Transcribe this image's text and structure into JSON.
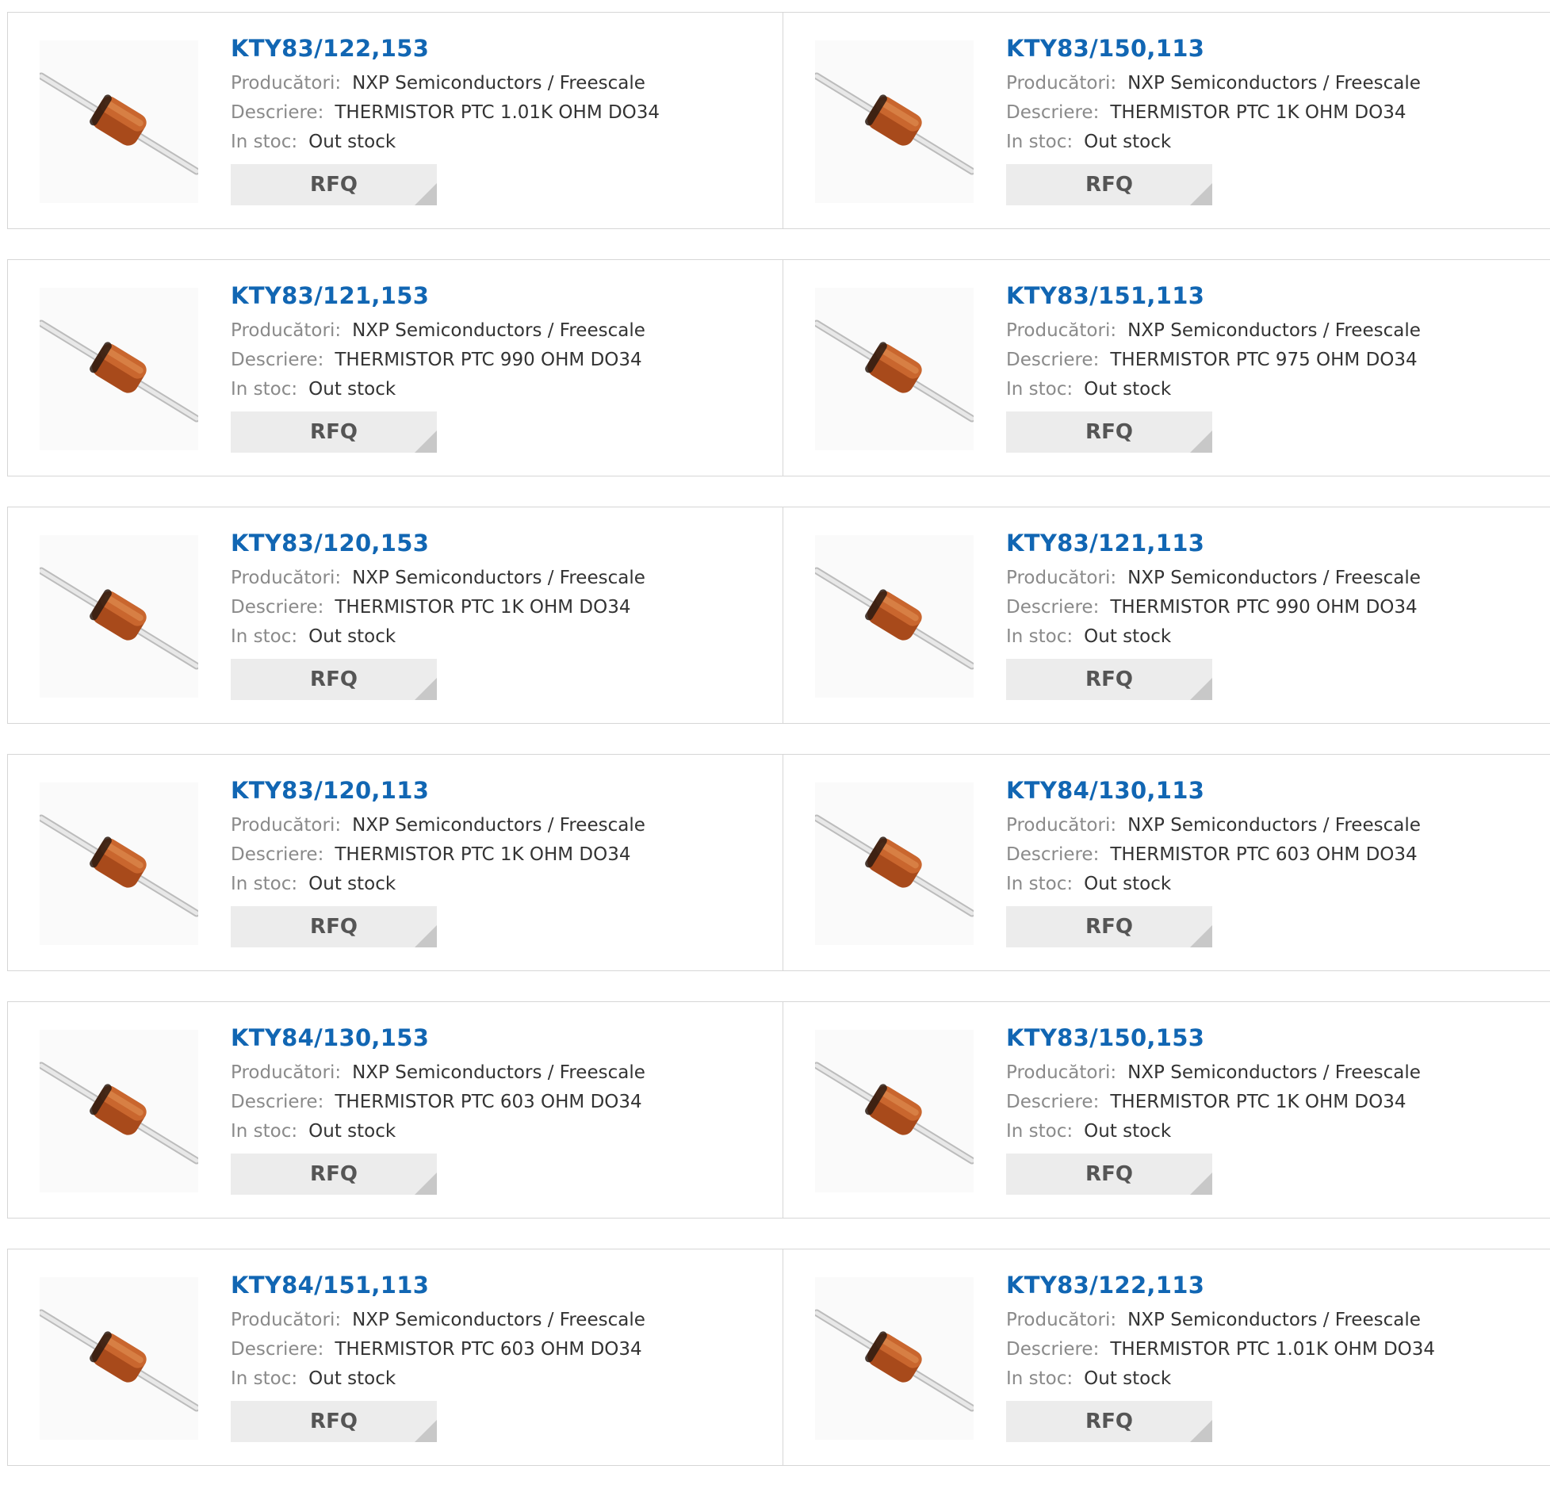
{
  "labels": {
    "manufacturer": "Producători:",
    "description": "Descriere:",
    "stock": "In stoc:",
    "rfq": "RFQ"
  },
  "products": [
    {
      "part": "KTY83/122,153",
      "manufacturer": "NXP Semiconductors / Freescale",
      "description": "THERMISTOR PTC 1.01K OHM DO34",
      "stock": "Out stock"
    },
    {
      "part": "KTY83/150,113",
      "manufacturer": "NXP Semiconductors / Freescale",
      "description": "THERMISTOR PTC 1K OHM DO34",
      "stock": "Out stock"
    },
    {
      "part": "KTY83/121,153",
      "manufacturer": "NXP Semiconductors / Freescale",
      "description": "THERMISTOR PTC 990 OHM DO34",
      "stock": "Out stock"
    },
    {
      "part": "KTY83/151,113",
      "manufacturer": "NXP Semiconductors / Freescale",
      "description": "THERMISTOR PTC 975 OHM DO34",
      "stock": "Out stock"
    },
    {
      "part": "KTY83/120,153",
      "manufacturer": "NXP Semiconductors / Freescale",
      "description": "THERMISTOR PTC 1K OHM DO34",
      "stock": "Out stock"
    },
    {
      "part": "KTY83/121,113",
      "manufacturer": "NXP Semiconductors / Freescale",
      "description": "THERMISTOR PTC 990 OHM DO34",
      "stock": "Out stock"
    },
    {
      "part": "KTY83/120,113",
      "manufacturer": "NXP Semiconductors / Freescale",
      "description": "THERMISTOR PTC 1K OHM DO34",
      "stock": "Out stock"
    },
    {
      "part": "KTY84/130,113",
      "manufacturer": "NXP Semiconductors / Freescale",
      "description": "THERMISTOR PTC 603 OHM DO34",
      "stock": "Out stock"
    },
    {
      "part": "KTY84/130,153",
      "manufacturer": "NXP Semiconductors / Freescale",
      "description": "THERMISTOR PTC 603 OHM DO34",
      "stock": "Out stock"
    },
    {
      "part": "KTY83/150,153",
      "manufacturer": "NXP Semiconductors / Freescale",
      "description": "THERMISTOR PTC 1K OHM DO34",
      "stock": "Out stock"
    },
    {
      "part": "KTY84/151,113",
      "manufacturer": "NXP Semiconductors / Freescale",
      "description": "THERMISTOR PTC 603 OHM DO34",
      "stock": "Out stock"
    },
    {
      "part": "KTY83/122,113",
      "manufacturer": "NXP Semiconductors / Freescale",
      "description": "THERMISTOR PTC 1.01K OHM DO34",
      "stock": "Out stock"
    }
  ],
  "colors": {
    "title": "#1166b3",
    "label": "#8a8a8a",
    "value": "#333333",
    "rfq_bg": "#ececec",
    "rfq_text": "#555555",
    "thermistor_body": "#b5531f",
    "lead": "#d4d4d4"
  },
  "icons": {
    "product_image": "thermistor-do34-icon",
    "rfq_corner": "corner-triangle-icon"
  }
}
